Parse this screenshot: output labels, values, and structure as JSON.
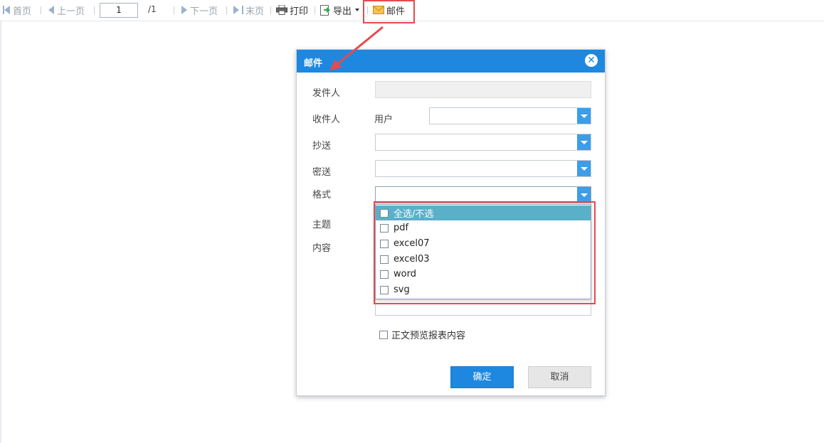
{
  "toolbar": {
    "first_label": "首页",
    "prev_label": "上一页",
    "page_value": "1",
    "page_total": "/1",
    "next_label": "下一页",
    "last_label": "末页",
    "print_label": "打印",
    "export_label": "导出",
    "mail_label": "邮件"
  },
  "dialog": {
    "title": "邮件",
    "close_icon": "close-icon",
    "fields": {
      "sender_label": "发件人",
      "recipient_label": "收件人",
      "recipient_sub_label": "用户",
      "cc_label": "抄送",
      "bcc_label": "密送",
      "format_label": "格式",
      "subject_label": "主题",
      "content_label": "内容"
    },
    "format_options": [
      "全选/不选",
      "pdf",
      "excel07",
      "excel03",
      "word",
      "svg"
    ],
    "selected_option_index": 0,
    "preview_label": "正文预览报表内容",
    "confirm_label": "确定",
    "cancel_label": "取消"
  },
  "colors": {
    "header_blue": "#1e88e0",
    "highlight_red": "#e64a4f",
    "selected_row": "#5ab0c9"
  }
}
